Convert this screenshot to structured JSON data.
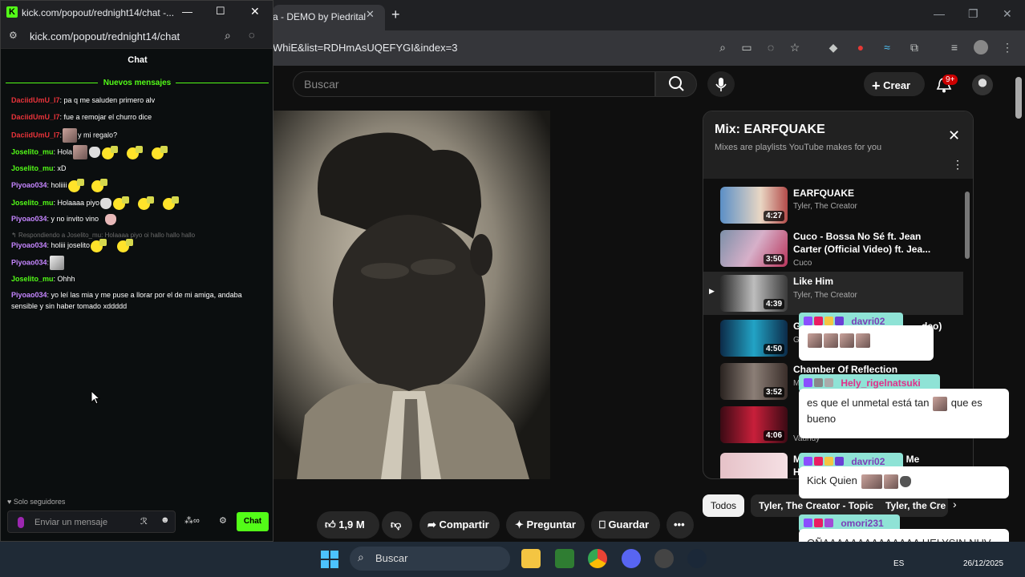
{
  "browser": {
    "tab_title": "a - DEMO by Piedrital",
    "url": "WhiE&list=RDHmAsUQEFYGI&index=3"
  },
  "youtube": {
    "search_placeholder": "Buscar",
    "create_label": "Crear",
    "notif_count": "9+",
    "mix": {
      "title": "Mix: EARFQUAKE",
      "subtitle": "Mixes are playlists YouTube makes for you",
      "items": [
        {
          "title": "EARFQUAKE",
          "artist": "Tyler, The Creator",
          "duration": "4:27"
        },
        {
          "title": "Cuco - Bossa No Sé ft. Jean Carter (Official Video) ft. Jea...",
          "artist": "Cuco",
          "duration": "3:50"
        },
        {
          "title": "Like Him",
          "artist": "Tyler, The Creator",
          "duration": "4:39"
        },
        {
          "title": "G",
          "artist": "G",
          "duration": "4:50",
          "title_tail": "deo)"
        },
        {
          "title": "Chamber Of Reflection",
          "artist": "M",
          "duration": "3:52"
        },
        {
          "title": "",
          "artist": "Vaundy",
          "duration": "4:06"
        },
        {
          "title": "M",
          "artist": "",
          "duration": "",
          "title_tail": "n Me",
          "title_line2": "H"
        }
      ]
    },
    "chips": [
      "Todos",
      "Tyler, The Creator - Topic",
      "Tyler, the Cre"
    ],
    "actions": {
      "likes": "1,9 M",
      "share": "Compartir",
      "ask": "Preguntar",
      "save": "Guardar"
    }
  },
  "kick": {
    "window_title": "kick.com/popout/rednight14/chat -...",
    "url": "kick.com/popout/rednight14/chat",
    "chat_header": "Chat",
    "new_messages": "Nuevos mensajes",
    "messages": [
      {
        "user": "DaciidUmU_I7",
        "text": ": pa q me saluden primero alv"
      },
      {
        "user": "DaciidUmU_I7",
        "text": ": fue a remojar el churro dice"
      },
      {
        "user": "DaciidUmU_I7",
        "text": ":",
        "text2": "y mi regalo?"
      },
      {
        "user": "Joselito_mu",
        "text": ": Hola"
      },
      {
        "user": "Joselito_mu",
        "text": ": xD"
      },
      {
        "user": "Piyoao034",
        "text": ": holiiii"
      },
      {
        "user": "Joselito_mu",
        "text": ": Holaaaa piyo"
      },
      {
        "user": "Piyoao034",
        "text": ": y no invito vino"
      },
      {
        "user": "Piyoao034",
        "text": ": holiii joselito"
      },
      {
        "user": "Piyoao034",
        "text": ":"
      },
      {
        "user": "Joselito_mu",
        "text": ": Ohhh"
      },
      {
        "user": "Piyoao034",
        "text": ": yo leí las mia y me puse a llorar por el de mi amiga, andaba sensible y sin haber tomado xddddd"
      }
    ],
    "reply_note": "Respondiendo a Joselito_mu: Holaaaa piyo oi hallo hallo hallo",
    "followers_only": "Solo seguidores",
    "input_placeholder": "Enviar un mensaje",
    "send_label": "Chat"
  },
  "overlay": [
    {
      "user": "davri02",
      "message": ""
    },
    {
      "user": "Hely_rigelnatsuki",
      "message": "es que el unmetal está tan",
      "message_tail": "que es bueno"
    },
    {
      "user": "davri02",
      "message": "Kick Quien"
    },
    {
      "user": "omori231",
      "message": "OÑAAAAAAAAAAAAAA HELYSIN NUV"
    }
  ],
  "taskbar": {
    "search_label": "Buscar",
    "lang": "ES",
    "date": "26/12/2025"
  }
}
